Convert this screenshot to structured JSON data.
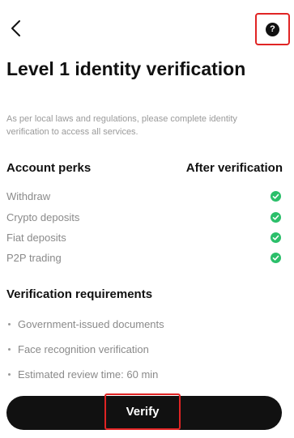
{
  "header": {
    "back_icon": "chevron-left-icon",
    "help_icon": "question-circle-icon",
    "help_glyph": "?"
  },
  "title": "Level 1 identity verification",
  "subtitle": "As per local laws and regulations, please complete identity verification to access all services.",
  "perks": {
    "header_left": "Account perks",
    "header_right": "After verification",
    "items": [
      {
        "label": "Withdraw",
        "status": "check"
      },
      {
        "label": "Crypto deposits",
        "status": "check"
      },
      {
        "label": "Fiat deposits",
        "status": "check"
      },
      {
        "label": "P2P trading",
        "status": "check"
      }
    ]
  },
  "requirements": {
    "title": "Verification requirements",
    "items": [
      "Government-issued documents",
      "Face recognition verification",
      "Estimated review time: 60 min"
    ]
  },
  "verify_button": {
    "label": "Verify"
  },
  "colors": {
    "primary": "#111111",
    "check": "#2bbf6a",
    "highlight": "#e02424",
    "muted_text": "#8a8a8a"
  }
}
